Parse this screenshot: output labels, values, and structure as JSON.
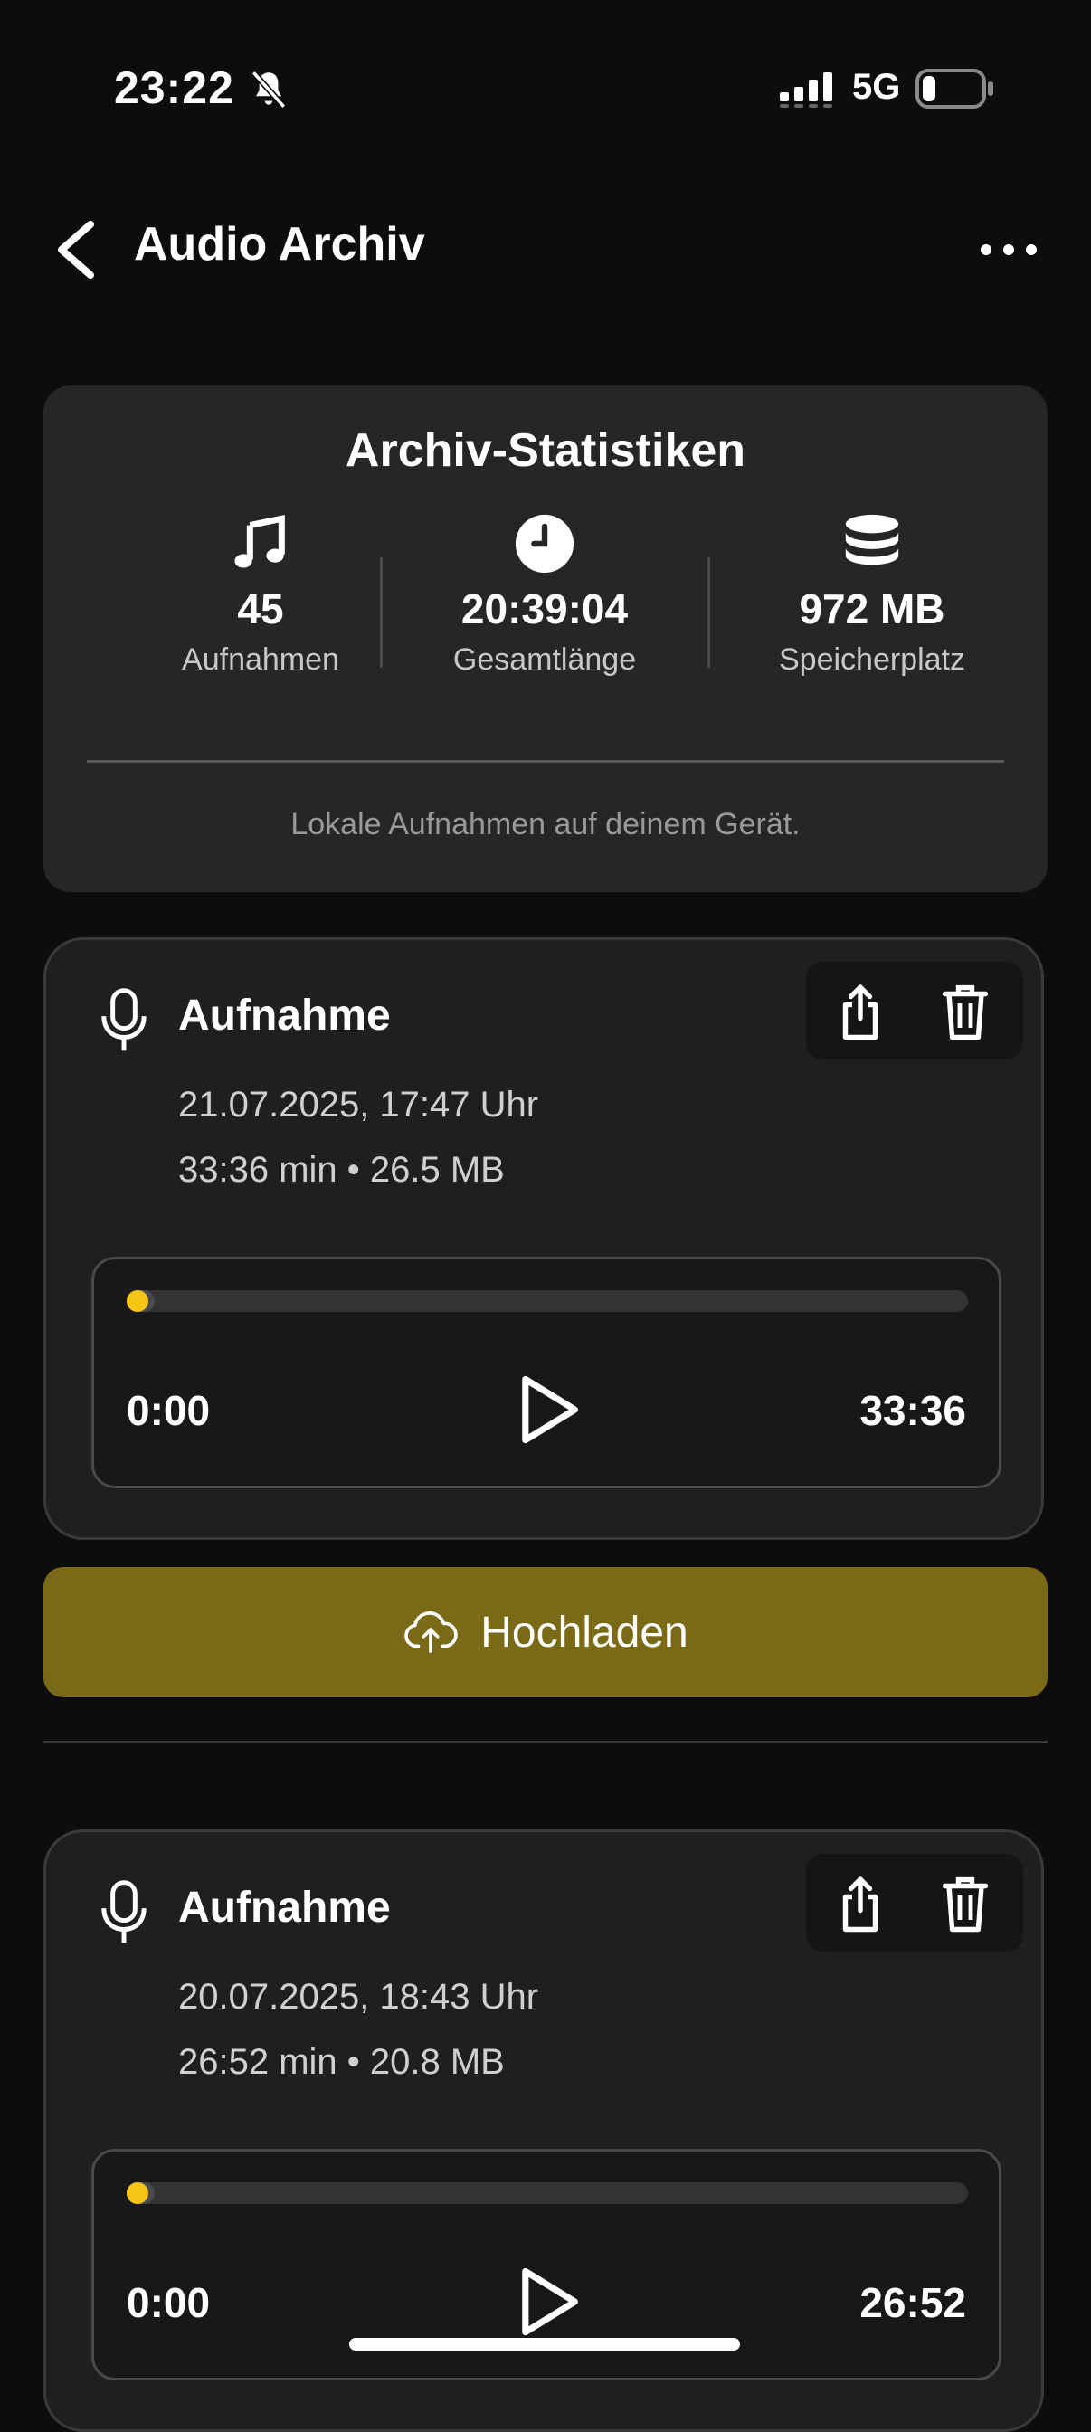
{
  "status_bar": {
    "time": "23:22",
    "network": "5G"
  },
  "header": {
    "title": "Audio Archiv"
  },
  "stats": {
    "title": "Archiv-Statistiken",
    "items": [
      {
        "icon": "music-note-icon",
        "value": "45",
        "label": "Aufnahmen"
      },
      {
        "icon": "clock-icon",
        "value": "20:39:04",
        "label": "Gesamtlänge"
      },
      {
        "icon": "database-icon",
        "value": "972 MB",
        "label": "Speicherplatz"
      }
    ],
    "note": "Lokale Aufnahmen auf deinem Gerät."
  },
  "recordings": [
    {
      "title": "Aufnahme",
      "date": "21.07.2025, 17:47 Uhr",
      "meta": "33:36 min • 26.5 MB",
      "current_time": "0:00",
      "total_time": "33:36",
      "progress": 0.02
    },
    {
      "title": "Aufnahme",
      "date": "20.07.2025, 18:43 Uhr",
      "meta": "26:52 min • 20.8 MB",
      "current_time": "0:00",
      "total_time": "26:52",
      "progress": 0.02
    }
  ],
  "upload_button": {
    "label": "Hochladen"
  },
  "colors": {
    "accent": "#f5c518",
    "upload_button": "#7a6a18",
    "background": "#0d0d0d",
    "card": "#262626"
  }
}
